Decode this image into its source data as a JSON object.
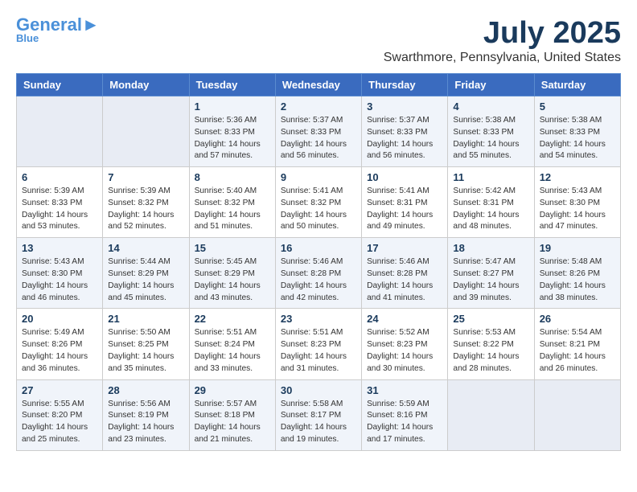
{
  "logo": {
    "general": "General",
    "blue": "Blue"
  },
  "title": "July 2025",
  "subtitle": "Swarthmore, Pennsylvania, United States",
  "weekdays": [
    "Sunday",
    "Monday",
    "Tuesday",
    "Wednesday",
    "Thursday",
    "Friday",
    "Saturday"
  ],
  "weeks": [
    [
      {
        "day": "",
        "info": ""
      },
      {
        "day": "",
        "info": ""
      },
      {
        "day": "1",
        "info": "Sunrise: 5:36 AM\nSunset: 8:33 PM\nDaylight: 14 hours\nand 57 minutes."
      },
      {
        "day": "2",
        "info": "Sunrise: 5:37 AM\nSunset: 8:33 PM\nDaylight: 14 hours\nand 56 minutes."
      },
      {
        "day": "3",
        "info": "Sunrise: 5:37 AM\nSunset: 8:33 PM\nDaylight: 14 hours\nand 56 minutes."
      },
      {
        "day": "4",
        "info": "Sunrise: 5:38 AM\nSunset: 8:33 PM\nDaylight: 14 hours\nand 55 minutes."
      },
      {
        "day": "5",
        "info": "Sunrise: 5:38 AM\nSunset: 8:33 PM\nDaylight: 14 hours\nand 54 minutes."
      }
    ],
    [
      {
        "day": "6",
        "info": "Sunrise: 5:39 AM\nSunset: 8:33 PM\nDaylight: 14 hours\nand 53 minutes."
      },
      {
        "day": "7",
        "info": "Sunrise: 5:39 AM\nSunset: 8:32 PM\nDaylight: 14 hours\nand 52 minutes."
      },
      {
        "day": "8",
        "info": "Sunrise: 5:40 AM\nSunset: 8:32 PM\nDaylight: 14 hours\nand 51 minutes."
      },
      {
        "day": "9",
        "info": "Sunrise: 5:41 AM\nSunset: 8:32 PM\nDaylight: 14 hours\nand 50 minutes."
      },
      {
        "day": "10",
        "info": "Sunrise: 5:41 AM\nSunset: 8:31 PM\nDaylight: 14 hours\nand 49 minutes."
      },
      {
        "day": "11",
        "info": "Sunrise: 5:42 AM\nSunset: 8:31 PM\nDaylight: 14 hours\nand 48 minutes."
      },
      {
        "day": "12",
        "info": "Sunrise: 5:43 AM\nSunset: 8:30 PM\nDaylight: 14 hours\nand 47 minutes."
      }
    ],
    [
      {
        "day": "13",
        "info": "Sunrise: 5:43 AM\nSunset: 8:30 PM\nDaylight: 14 hours\nand 46 minutes."
      },
      {
        "day": "14",
        "info": "Sunrise: 5:44 AM\nSunset: 8:29 PM\nDaylight: 14 hours\nand 45 minutes."
      },
      {
        "day": "15",
        "info": "Sunrise: 5:45 AM\nSunset: 8:29 PM\nDaylight: 14 hours\nand 43 minutes."
      },
      {
        "day": "16",
        "info": "Sunrise: 5:46 AM\nSunset: 8:28 PM\nDaylight: 14 hours\nand 42 minutes."
      },
      {
        "day": "17",
        "info": "Sunrise: 5:46 AM\nSunset: 8:28 PM\nDaylight: 14 hours\nand 41 minutes."
      },
      {
        "day": "18",
        "info": "Sunrise: 5:47 AM\nSunset: 8:27 PM\nDaylight: 14 hours\nand 39 minutes."
      },
      {
        "day": "19",
        "info": "Sunrise: 5:48 AM\nSunset: 8:26 PM\nDaylight: 14 hours\nand 38 minutes."
      }
    ],
    [
      {
        "day": "20",
        "info": "Sunrise: 5:49 AM\nSunset: 8:26 PM\nDaylight: 14 hours\nand 36 minutes."
      },
      {
        "day": "21",
        "info": "Sunrise: 5:50 AM\nSunset: 8:25 PM\nDaylight: 14 hours\nand 35 minutes."
      },
      {
        "day": "22",
        "info": "Sunrise: 5:51 AM\nSunset: 8:24 PM\nDaylight: 14 hours\nand 33 minutes."
      },
      {
        "day": "23",
        "info": "Sunrise: 5:51 AM\nSunset: 8:23 PM\nDaylight: 14 hours\nand 31 minutes."
      },
      {
        "day": "24",
        "info": "Sunrise: 5:52 AM\nSunset: 8:23 PM\nDaylight: 14 hours\nand 30 minutes."
      },
      {
        "day": "25",
        "info": "Sunrise: 5:53 AM\nSunset: 8:22 PM\nDaylight: 14 hours\nand 28 minutes."
      },
      {
        "day": "26",
        "info": "Sunrise: 5:54 AM\nSunset: 8:21 PM\nDaylight: 14 hours\nand 26 minutes."
      }
    ],
    [
      {
        "day": "27",
        "info": "Sunrise: 5:55 AM\nSunset: 8:20 PM\nDaylight: 14 hours\nand 25 minutes."
      },
      {
        "day": "28",
        "info": "Sunrise: 5:56 AM\nSunset: 8:19 PM\nDaylight: 14 hours\nand 23 minutes."
      },
      {
        "day": "29",
        "info": "Sunrise: 5:57 AM\nSunset: 8:18 PM\nDaylight: 14 hours\nand 21 minutes."
      },
      {
        "day": "30",
        "info": "Sunrise: 5:58 AM\nSunset: 8:17 PM\nDaylight: 14 hours\nand 19 minutes."
      },
      {
        "day": "31",
        "info": "Sunrise: 5:59 AM\nSunset: 8:16 PM\nDaylight: 14 hours\nand 17 minutes."
      },
      {
        "day": "",
        "info": ""
      },
      {
        "day": "",
        "info": ""
      }
    ]
  ]
}
